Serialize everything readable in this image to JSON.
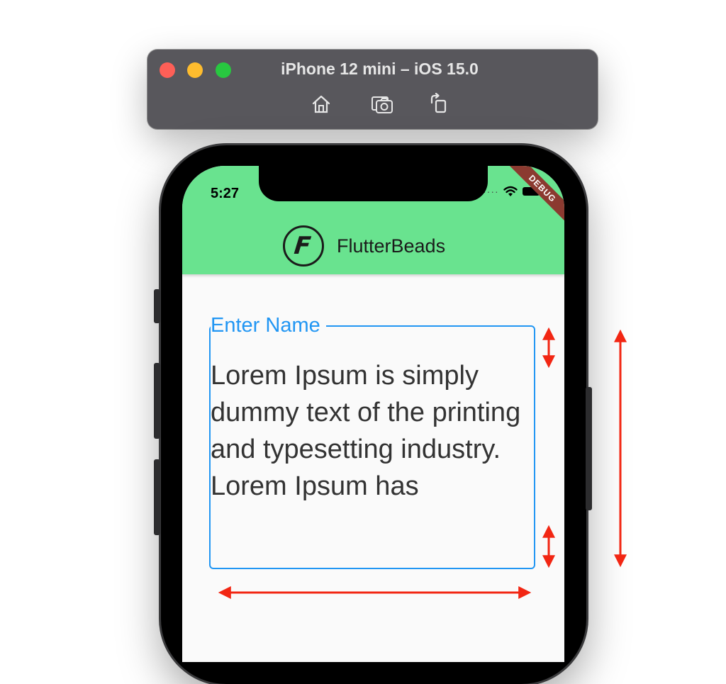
{
  "window": {
    "title": "iPhone 12 mini – iOS 15.0",
    "toolbar": [
      {
        "icon": "home-icon"
      },
      {
        "icon": "screenshot-icon"
      },
      {
        "icon": "rotate-icon"
      }
    ]
  },
  "status_bar": {
    "time": "5:27",
    "debug_banner": "DEBUG"
  },
  "app_bar": {
    "logo_letter": "F",
    "title": "FlutterBeads",
    "color": "#69e38f"
  },
  "text_field": {
    "label": "Enter Name",
    "value": "Lorem Ipsum is simply dummy text of the printing and typesetting industry. Lorem Ipsum has",
    "accent": "#2196f3"
  },
  "annotation_color": "#f22613"
}
